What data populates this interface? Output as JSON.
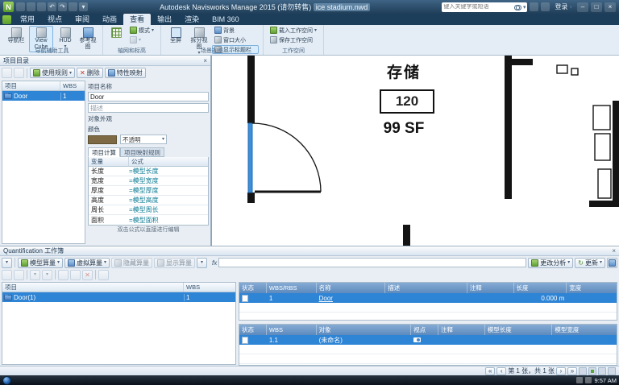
{
  "icons": {
    "app_logo": "N",
    "dropdown": "▾",
    "close": "×",
    "undo": "↶",
    "redo": "↷",
    "min": "–",
    "max": "□",
    "win_close": "×",
    "nav_first": "«",
    "nav_prev": "‹",
    "nav_next": "›",
    "nav_last": "»",
    "delete_x": "✕",
    "update": "↻"
  },
  "titlebar": {
    "app_title": "Autodesk Navisworks Manage 2015 (请勿转售)",
    "doc_name": "ice stadium.nwd",
    "search_placeholder": "键入关键字或短语",
    "signin": "登录"
  },
  "ribbon": {
    "tabs": [
      {
        "label": "常用"
      },
      {
        "label": "视点"
      },
      {
        "label": "审阅"
      },
      {
        "label": "动画"
      },
      {
        "label": "查看"
      },
      {
        "label": "输出"
      },
      {
        "label": "渲染"
      },
      {
        "label": "BIM 360"
      }
    ],
    "groups": {
      "nav": {
        "label": "导航辅助工具",
        "navbar": "导航栏",
        "viewcube": "View Cube",
        "hud": "HUD",
        "refviews": "参考视图"
      },
      "grid": {
        "label": "轴网和标高",
        "mode": "模式"
      },
      "scene": {
        "label": "场景视图",
        "fullscreen": "全屏",
        "split": "拆分视图",
        "background": "背景",
        "window_size": "窗口大小",
        "show_title_bars": "显示标题栏"
      },
      "workspace": {
        "label": "工作空间",
        "load": "载入工作空间",
        "save": "保存工作空间"
      }
    }
  },
  "catalog": {
    "title": "项目目录",
    "toolbar": {
      "use_rule": "使用规则",
      "delete": "删除",
      "prop_mapping": "特性映射"
    },
    "tree": {
      "col_item": "项目",
      "col_wbs": "WBS",
      "row_name": "Door",
      "row_wbs": "1"
    },
    "detail": {
      "name_label": "项目名称",
      "name_value": "Door",
      "desc_placeholder": "描述",
      "appearance_label": "对象外观",
      "color_label": "颜色",
      "opacity_value": "不透明",
      "tab_calc": "项目计算",
      "tab_mapping": "项目映射规则",
      "col_var": "变量",
      "col_formula": "公式",
      "formulas": [
        {
          "v": "长度",
          "f": "=模型长度"
        },
        {
          "v": "宽度",
          "f": "=模型宽度"
        },
        {
          "v": "厚度",
          "f": "=模型厚度"
        },
        {
          "v": "高度",
          "f": "=模型高度"
        },
        {
          "v": "周长",
          "f": "=模型周长"
        },
        {
          "v": "面积",
          "f": "=模型面积"
        }
      ],
      "hint": "双击公式以直接进行编辑"
    }
  },
  "plan": {
    "room_name": "存储",
    "room_number": "120",
    "room_area": "99 SF"
  },
  "quant": {
    "title": "Quantification 工作簿",
    "toolbar": {
      "model_takeoff": "模型算量",
      "virtual_takeoff": "虚拟算量",
      "hide_takeoff": "隐藏算量",
      "show_takeoff": "显示算量",
      "fx_label": "fx",
      "change_analysis": "更改分析",
      "update": "更新"
    },
    "tree": {
      "col_item": "项目",
      "col_wbs": "WBS",
      "row_name": "Door(1)",
      "row_wbs": "1"
    },
    "table1": {
      "headers": [
        "状态",
        "WBS/RBS",
        "名称",
        "描述",
        "注释",
        "长度",
        "宽度"
      ],
      "row": {
        "wbs": "1",
        "name": "Door",
        "length": "0.000 m"
      }
    },
    "table2": {
      "headers": [
        "状态",
        "WBS",
        "对象",
        "视点",
        "注释",
        "模型长度",
        "模型宽度"
      ],
      "row": {
        "wbs": "1.1",
        "object": "(未命名)"
      }
    }
  },
  "statusbar": {
    "sheet_info": "第 1 张，共 1 张"
  },
  "taskbar": {
    "clock": "9:57 AM"
  }
}
